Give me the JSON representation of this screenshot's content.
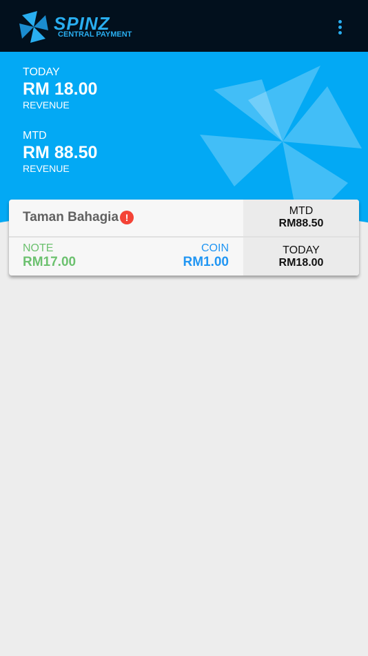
{
  "app": {
    "brand_name": "SPINZ",
    "brand_tagline": "CENTRAL PAYMENT",
    "accent_color": "#29aef0",
    "menu_icon": "more-vert-icon"
  },
  "summary": {
    "today_label": "TODAY",
    "today_value": "RM 18.00",
    "today_sub": "REVENUE",
    "mtd_label": "MTD",
    "mtd_value": "RM 88.50",
    "mtd_sub": "REVENUE",
    "background_color": "#03a9f4"
  },
  "stations": [
    {
      "name": "Taman Bahagia",
      "alert_icon": "alert-icon",
      "note_label": "NOTE",
      "note_value": "RM17.00",
      "coin_label": "COIN",
      "coin_value": "RM1.00",
      "mtd_label": "MTD",
      "mtd_value": "RM88.50",
      "today_label": "TODAY",
      "today_value": "RM18.00",
      "note_color": "#6cc16f",
      "coin_color": "#2196f3",
      "alert_color": "#f44336"
    }
  ]
}
